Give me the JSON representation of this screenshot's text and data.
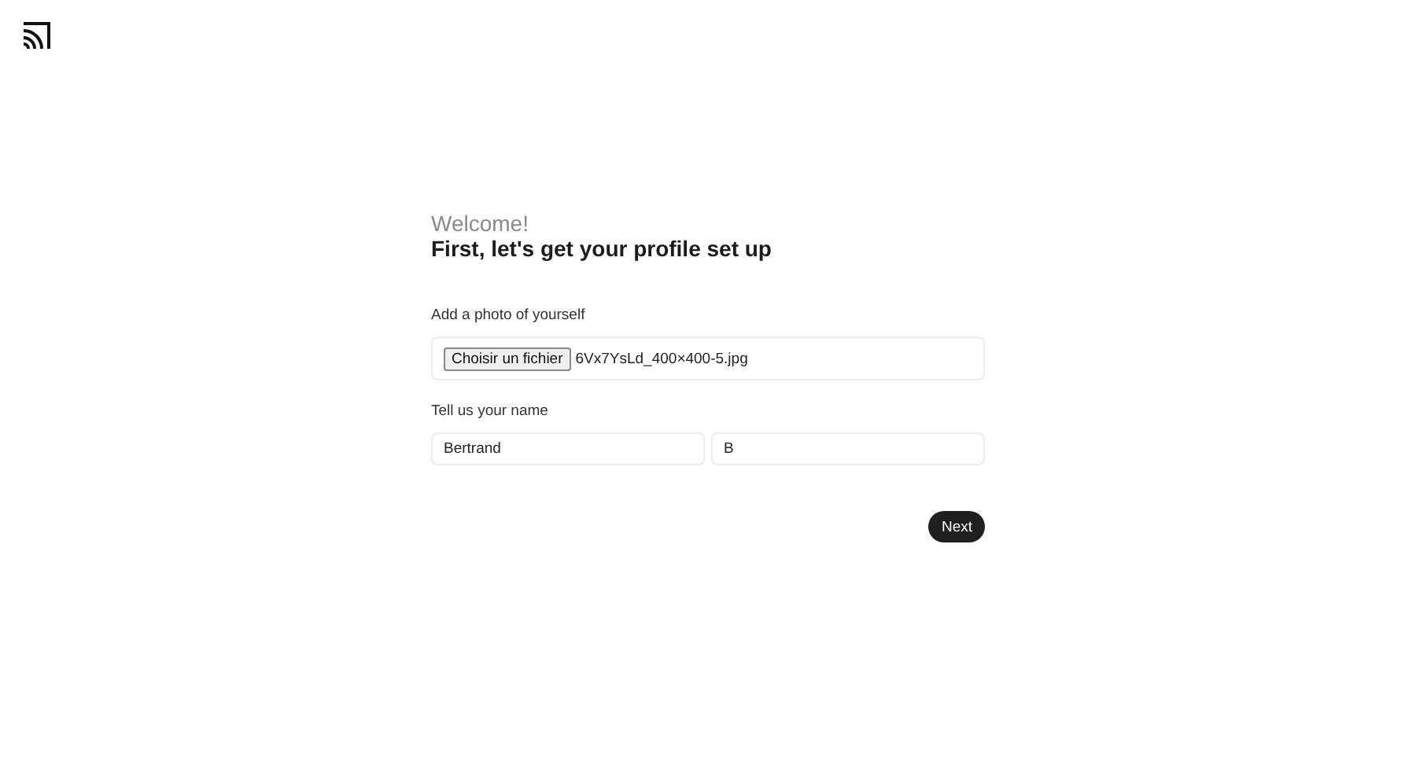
{
  "greeting": "Welcome!",
  "heading": "First, let's get your profile set up",
  "photo": {
    "label": "Add a photo of yourself",
    "button": "Choisir un fichier",
    "file_name": "6Vx7YsLd_400×400-5.jpg"
  },
  "name": {
    "label": "Tell us your name",
    "first": "Bertrand",
    "last": "B"
  },
  "next_button": "Next"
}
